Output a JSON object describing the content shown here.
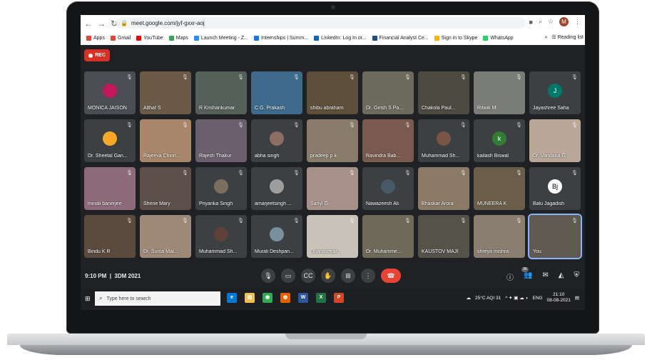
{
  "browser": {
    "url": "meet.google.com/jyf-gxxr-aoj",
    "profile_initial": "M",
    "bookmarks": [
      {
        "label": "Apps",
        "color": "#ea4335"
      },
      {
        "label": "Gmail",
        "color": "#ea4335"
      },
      {
        "label": "YouTube",
        "color": "#ff0000"
      },
      {
        "label": "Maps",
        "color": "#34a853"
      },
      {
        "label": "Launch Meeting - Z...",
        "color": "#2d8cff"
      },
      {
        "label": "Internships | Summ...",
        "color": "#1a73e8"
      },
      {
        "label": "LinkedIn: Log In or...",
        "color": "#0a66c2"
      },
      {
        "label": "Financial Analyst Ce...",
        "color": "#1a4c8b"
      },
      {
        "label": "Sign in to Skype",
        "color": "#f4b400"
      },
      {
        "label": "WhatsApp",
        "color": "#25d366"
      }
    ],
    "more_bookmarks": "»",
    "reading_list": "Reading list"
  },
  "meet": {
    "rec_label": "REC",
    "participants": [
      {
        "name": "MONICA JAISON",
        "bg": "#4a4e52",
        "avatar": "",
        "avatar_color": "#c2185b"
      },
      {
        "name": "Althaf S",
        "bg": "#6b5a48",
        "avatar": "",
        "avatar_color": ""
      },
      {
        "name": "R Krishankumar",
        "bg": "#55605a",
        "avatar": "",
        "avatar_color": ""
      },
      {
        "name": "C.G. Prakash",
        "bg": "#3e6b8c",
        "avatar": "",
        "avatar_color": ""
      },
      {
        "name": "shibu abraham",
        "bg": "#5e4f3b",
        "avatar": "",
        "avatar_color": ""
      },
      {
        "name": "Dr. Girish S Pa...",
        "bg": "#6d6a5e",
        "avatar": "",
        "avatar_color": ""
      },
      {
        "name": "Chakola Paul...",
        "bg": "#4d4a42",
        "avatar": "",
        "avatar_color": ""
      },
      {
        "name": "Ritwik M",
        "bg": "#7a7c78",
        "avatar": "",
        "avatar_color": ""
      },
      {
        "name": "Jayashree Saha",
        "bg": "#3c4043",
        "avatar": "J",
        "avatar_color": "#00796b"
      },
      {
        "name": "Dr. Sheetal Gan...",
        "bg": "#3c4043",
        "avatar": "",
        "avatar_color": "#f9a825"
      },
      {
        "name": "Rajeeva Chinn...",
        "bg": "#a8866a",
        "avatar": "",
        "avatar_color": ""
      },
      {
        "name": "Rajesh Thakur",
        "bg": "#6b5f6e",
        "avatar": "",
        "avatar_color": ""
      },
      {
        "name": "abha singh",
        "bg": "#3c4043",
        "avatar": "",
        "avatar_color": "#8d6e63"
      },
      {
        "name": "pradeep p k",
        "bg": "#8a7c6a",
        "avatar": "",
        "avatar_color": ""
      },
      {
        "name": "Ravindra Bab...",
        "bg": "#7a5a4e",
        "avatar": "",
        "avatar_color": ""
      },
      {
        "name": "Muhammad Sh...",
        "bg": "#3c4043",
        "avatar": "",
        "avatar_color": "#795548"
      },
      {
        "name": "kailash Biswal",
        "bg": "#3c4043",
        "avatar": "k",
        "avatar_color": "#2e7d32"
      },
      {
        "name": "Dr. Vandana G...",
        "bg": "#b9a898",
        "avatar": "",
        "avatar_color": ""
      },
      {
        "name": "minali banerjee",
        "bg": "#8c6a78",
        "avatar": "",
        "avatar_color": ""
      },
      {
        "name": "Shrine Mary",
        "bg": "#5c5048",
        "avatar": "",
        "avatar_color": ""
      },
      {
        "name": "Priyanka Singh",
        "bg": "#3c4043",
        "avatar": "",
        "avatar_color": "#7b6e5e"
      },
      {
        "name": "amarjeetsingh ...",
        "bg": "#3c4043",
        "avatar": "",
        "avatar_color": "#9e9e9e"
      },
      {
        "name": "Sanyl G",
        "bg": "#a8908a",
        "avatar": "",
        "avatar_color": ""
      },
      {
        "name": "Nawazeesh Ali",
        "bg": "#3c4043",
        "avatar": "",
        "avatar_color": "#455a64"
      },
      {
        "name": "Bhaskar Arora",
        "bg": "#8a7a66",
        "avatar": "",
        "avatar_color": ""
      },
      {
        "name": "MUNEERA K",
        "bg": "#6a5e4a",
        "avatar": "",
        "avatar_color": ""
      },
      {
        "name": "Balu Jagadish",
        "bg": "#3c4043",
        "avatar": "Bj",
        "avatar_color": "#ffffff"
      },
      {
        "name": "Bindu K R",
        "bg": "#5b4a3e",
        "avatar": "",
        "avatar_color": ""
      },
      {
        "name": "Dr. Suma Mat...",
        "bg": "#9e8878",
        "avatar": "",
        "avatar_color": ""
      },
      {
        "name": "Muhammad Sh...",
        "bg": "#3c4043",
        "avatar": "",
        "avatar_color": "#5d4037"
      },
      {
        "name": "Murali Deshpan...",
        "bg": "#3c4043",
        "avatar": "",
        "avatar_color": "#78909c"
      },
      {
        "name": "Dhanasekar...",
        "bg": "#c8c2b8",
        "avatar": "",
        "avatar_color": ""
      },
      {
        "name": "Dr. Muhamme...",
        "bg": "#6e6a5a",
        "avatar": "",
        "avatar_color": ""
      },
      {
        "name": "KAUSTOV MAJI",
        "bg": "#55524a",
        "avatar": "",
        "avatar_color": ""
      },
      {
        "name": "shreya mishra",
        "bg": "#8a7e70",
        "avatar": "",
        "avatar_color": ""
      },
      {
        "name": "You",
        "bg": "#5e5a52",
        "avatar": "",
        "avatar_color": ""
      }
    ],
    "clock": "9:10 PM",
    "separator": "|",
    "meeting_code": "3DM 2021",
    "people_count": "36"
  },
  "taskbar": {
    "search_placeholder": "Type here to search",
    "weather": "25°C AQI 31",
    "language": "ENG",
    "time": "21:10",
    "date": "08-08-2021"
  }
}
